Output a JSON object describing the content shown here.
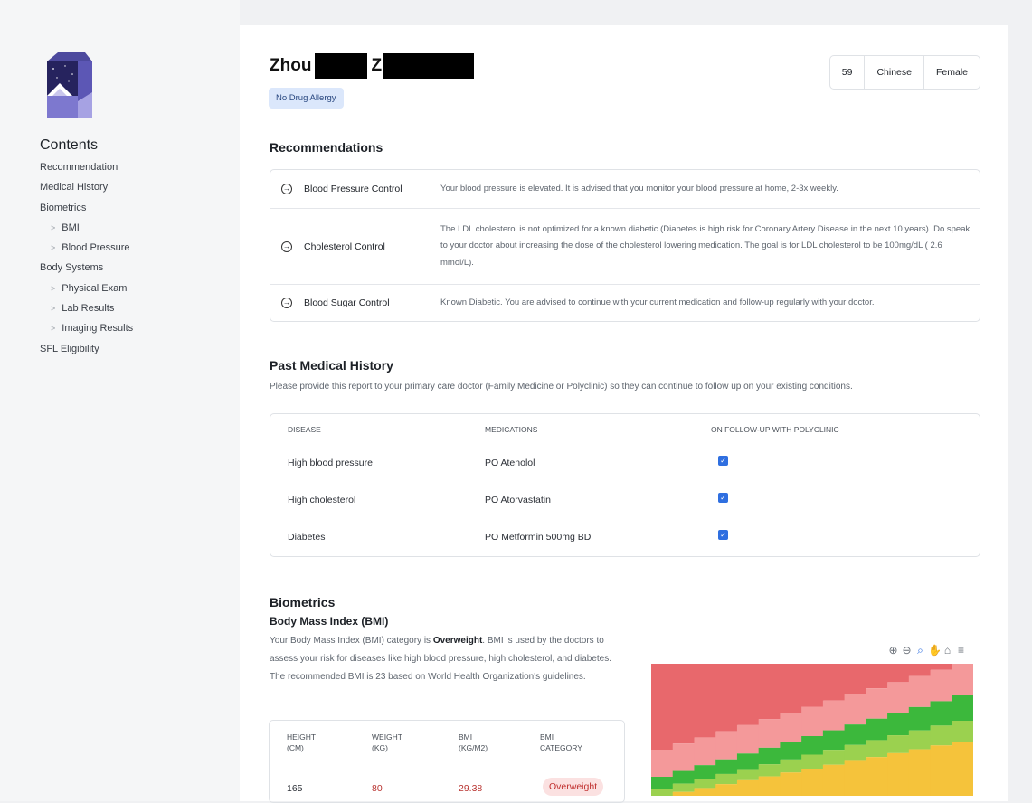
{
  "sidebar": {
    "contents_title": "Contents",
    "items": [
      {
        "label": "Recommendation",
        "sub": false
      },
      {
        "label": "Medical History",
        "sub": false
      },
      {
        "label": "Biometrics",
        "sub": false
      },
      {
        "label": "BMI",
        "sub": true
      },
      {
        "label": "Blood Pressure",
        "sub": true
      },
      {
        "label": "Body Systems",
        "sub": false
      },
      {
        "label": "Physical Exam",
        "sub": true
      },
      {
        "label": "Lab Results",
        "sub": true
      },
      {
        "label": "Imaging Results",
        "sub": true
      },
      {
        "label": "SFL Eligibility",
        "sub": false
      }
    ]
  },
  "patient": {
    "first_name": "Zhou",
    "initial": "Z",
    "allergy": "No Drug Allergy",
    "age": "59",
    "race": "Chinese",
    "gender": "Female"
  },
  "recommendations": {
    "title": "Recommendations",
    "items": [
      {
        "title": "Blood Pressure Control",
        "text": "Your blood pressure is elevated. It is advised that you monitor your blood pressure at home, 2-3x weekly."
      },
      {
        "title": "Cholesterol Control",
        "text": "The LDL cholesterol is not optimized for a known diabetic (Diabetes is high risk for Coronary Artery Disease in the next 10 years). Do speak to your doctor about increasing the dose of the cholesterol lowering medication. The goal is for LDL cholesterol to be 100mg/dL ( 2.6 mmol/L)."
      },
      {
        "title": "Blood Sugar Control",
        "text": "Known Diabetic. You are advised to continue with your current medication and follow-up regularly with your doctor."
      }
    ]
  },
  "pmh": {
    "title": "Past Medical History",
    "description": "Please provide this report to your primary care doctor (Family Medicine or Polyclinic) so they can continue to follow up on your existing conditions.",
    "columns": [
      "DISEASE",
      "MEDICATIONS",
      "ON FOLLOW-UP WITH POLYCLINIC"
    ],
    "rows": [
      {
        "disease": "High blood pressure",
        "medication": "PO Atenolol",
        "follow_up": true
      },
      {
        "disease": "High cholesterol",
        "medication": "PO Atorvastatin",
        "follow_up": true
      },
      {
        "disease": "Diabetes",
        "medication": "PO Metformin 500mg BD",
        "follow_up": true
      }
    ]
  },
  "biometrics": {
    "title": "Biometrics",
    "bmi_title": "Body Mass Index (BMI)",
    "desc_prefix": "Your Body Mass Index (BMI) category is ",
    "desc_category": "Overweight",
    "desc_suffix": ". BMI is used by the doctors to assess your risk for diseases like high blood pressure, high cholesterol, and diabetes. The recommended BMI is 23 based on World Health Organization's guidelines.",
    "columns": [
      {
        "line1": "HEIGHT",
        "line2": "(CM)"
      },
      {
        "line1": "WEIGHT",
        "line2": "(KG)"
      },
      {
        "line1": "BMI",
        "line2": "(KG/M2)"
      },
      {
        "line1": "BMI",
        "line2": "CATEGORY"
      }
    ],
    "height": "165",
    "weight": "80",
    "bmi": "29.38",
    "category": "Overweight",
    "value_color": "#b8322f"
  },
  "chart_tools": [
    "zoom-in-icon",
    "zoom-out-icon",
    "zoom-select-icon",
    "pan-hand-icon",
    "home-reset-icon",
    "menu-icon"
  ],
  "colors": {
    "obese": "#e8686c",
    "overweight": "#f4999a",
    "normal": "#3cb83c",
    "underweight_light": "#9bd14f",
    "underweight": "#f5c33b",
    "badge_bg": "#fbe1e1",
    "checkbox": "#2f6fe0"
  }
}
